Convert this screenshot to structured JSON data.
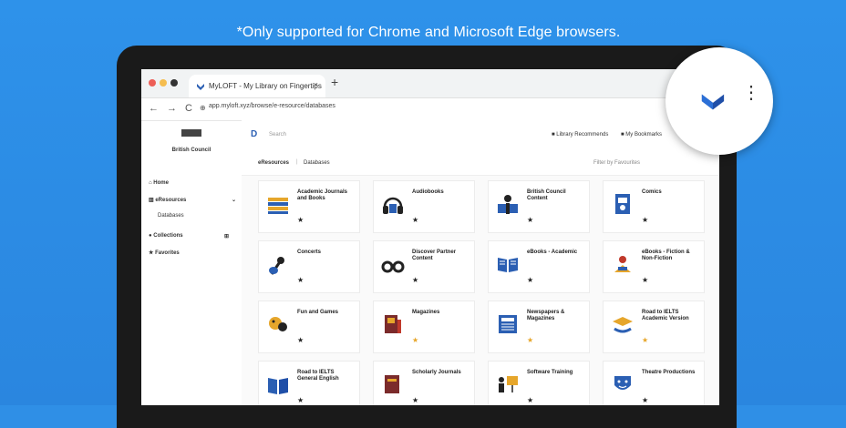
{
  "notice": "*Only supported for Chrome and Microsoft Edge browsers.",
  "browser": {
    "tab_title": "MyLOFT - My Library on Fingertips",
    "url": "app.myloft.xyz/browse/e-resource/databases",
    "close": "×",
    "new_tab": "+"
  },
  "sidebar": {
    "org": "British Council",
    "items": [
      {
        "label": "Home"
      },
      {
        "label": "eResources"
      },
      {
        "label": "Databases"
      },
      {
        "label": "Collections"
      },
      {
        "label": "Favorites"
      }
    ]
  },
  "topbar": {
    "search_placeholder": "Search",
    "library_recommends": "Library Recommends",
    "my_bookmarks": "My Bookmarks"
  },
  "subbar": {
    "crumb1": "eResources",
    "crumb2": "Databases",
    "filter": "Filter by Favourites"
  },
  "cards": [
    {
      "label": "Academic Journals and Books",
      "icon": "books-icon"
    },
    {
      "label": "Audiobooks",
      "icon": "headphones-icon"
    },
    {
      "label": "British Council Content",
      "icon": "reader-icon"
    },
    {
      "label": "Comics",
      "icon": "comic-icon"
    },
    {
      "label": "Concerts",
      "icon": "guitar-icon"
    },
    {
      "label": "Discover Partner Content",
      "icon": "binoculars-icon"
    },
    {
      "label": "eBooks - Academic",
      "icon": "open-book-icon"
    },
    {
      "label": "eBooks - Fiction & Non-Fiction",
      "icon": "reading-person-icon"
    },
    {
      "label": "Fun and Games",
      "icon": "games-icon"
    },
    {
      "label": "Magazines",
      "icon": "magazine-icon"
    },
    {
      "label": "Newspapers & Magazines",
      "icon": "newspaper-icon"
    },
    {
      "label": "Road to IELTS Academic Version",
      "icon": "graduation-icon"
    },
    {
      "label": "Road to IELTS General English",
      "icon": "blue-book-icon"
    },
    {
      "label": "Scholarly Journals",
      "icon": "journal-icon"
    },
    {
      "label": "Software Training",
      "icon": "presentation-icon"
    },
    {
      "label": "Theatre Productions",
      "icon": "theatre-mask-icon"
    }
  ],
  "colors": {
    "background": "#2e8fe8",
    "accent": "#2b5fb3",
    "brand_chevron": "#1f4fa8"
  }
}
